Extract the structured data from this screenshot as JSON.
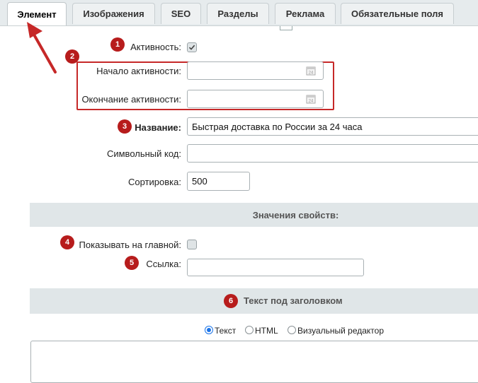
{
  "tabs": [
    {
      "label": "Элемент"
    },
    {
      "label": "Изображения"
    },
    {
      "label": "SEO"
    },
    {
      "label": "Разделы"
    },
    {
      "label": "Реклама"
    },
    {
      "label": "Обязательные поля"
    }
  ],
  "fields": {
    "active_label": "Активность:",
    "active_checked": true,
    "start_label": "Начало активности:",
    "start_value": "",
    "end_label": "Окончание активности:",
    "end_value": "",
    "name_label": "Название:",
    "name_value": "Быстрая доставка по России за 24 часа",
    "code_label": "Символьный код:",
    "code_value": "",
    "sort_label": "Сортировка:",
    "sort_value": "500"
  },
  "properties": {
    "header": "Значения свойств:",
    "show_main_label": "Показывать на главной:",
    "show_main_checked": false,
    "link_label": "Ссылка:",
    "link_value": ""
  },
  "text_section": {
    "header": "Текст под заголовком",
    "options": [
      "Текст",
      "HTML",
      "Визуальный редактор"
    ],
    "selected": "Текст"
  },
  "badges": [
    "1",
    "2",
    "3",
    "4",
    "5",
    "6"
  ],
  "colors": {
    "badge": "#b71c1c",
    "annotation": "#c62828",
    "radio_selected": "#1a73e8"
  }
}
